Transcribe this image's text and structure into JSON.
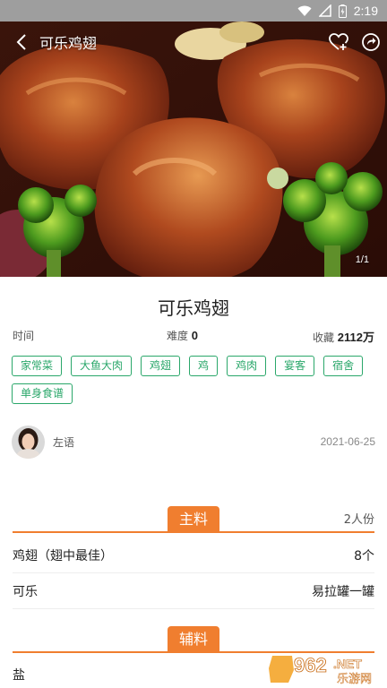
{
  "status_bar": {
    "time": "2:19",
    "icons": [
      "wifi-icon",
      "signal-icon",
      "battery-icon"
    ]
  },
  "nav": {
    "title": "可乐鸡翅",
    "actions": [
      "heart-plus-icon",
      "share-icon"
    ]
  },
  "hero": {
    "counter": "1/1"
  },
  "recipe": {
    "title": "可乐鸡翅",
    "time_label": "时间",
    "difficulty_label": "难度",
    "difficulty_value": "0",
    "favorites_label": "收藏",
    "favorites_value": "2112万"
  },
  "tags": [
    "家常菜",
    "大鱼大肉",
    "鸡翅",
    "鸡",
    "鸡肉",
    "宴客",
    "宿舍",
    "单身食谱"
  ],
  "author": {
    "name": "左语",
    "date": "2021-06-25"
  },
  "main_ingredients": {
    "heading": "主料",
    "servings": "2人份",
    "items": [
      {
        "name": "鸡翅（翅中最佳）",
        "amount": "8个"
      },
      {
        "name": "可乐",
        "amount": "易拉罐一罐"
      }
    ]
  },
  "secondary_ingredients": {
    "heading": "辅料",
    "items": [
      {
        "name": "盐",
        "amount": ""
      }
    ]
  },
  "watermark": {
    "text_number": "962",
    "text_suffix": ".NET",
    "text_cn": "乐游网"
  },
  "colors": {
    "accent_orange": "#f07e2f",
    "tag_green": "#2aa76a",
    "status_bar": "#9e9e9e"
  }
}
